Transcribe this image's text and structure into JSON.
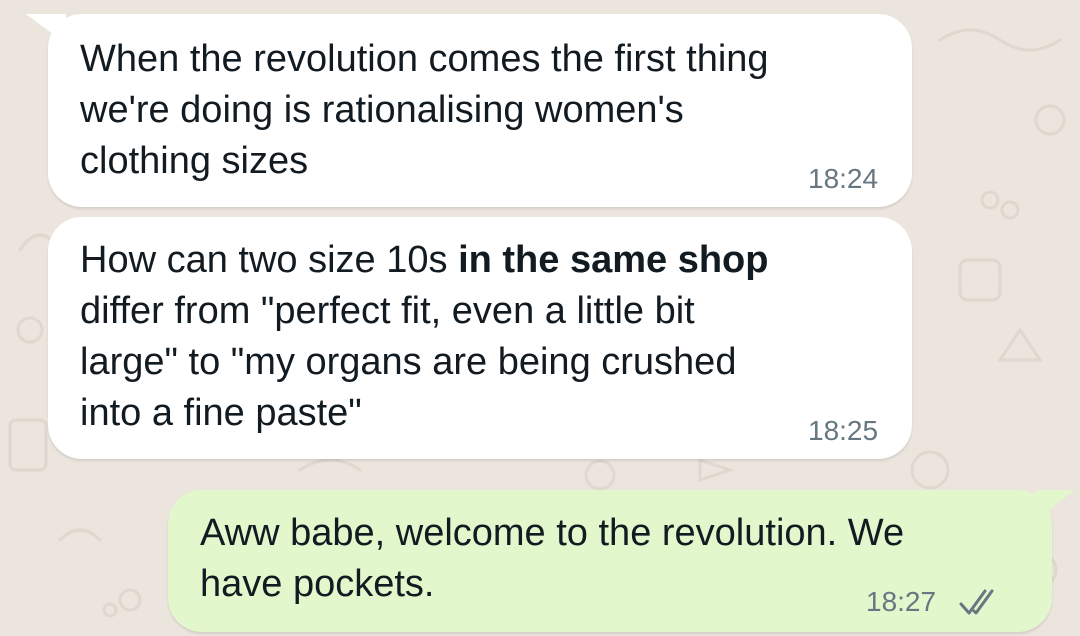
{
  "messages": [
    {
      "direction": "incoming",
      "text": "When the revolution comes the first thing\nwe're doing is rationalising women's\nclothing sizes",
      "time": "18:24"
    },
    {
      "direction": "incoming",
      "text_before_bold": "How can two size 10s ",
      "text_bold": "in the same shop",
      "text_after_bold": "\ndiffer from \"perfect fit, even a little bit\nlarge\" to \"my organs are being crushed\ninto a fine paste\"",
      "time": "18:25"
    },
    {
      "direction": "outgoing",
      "text": "Aww babe, welcome to the revolution. We\nhave pockets.",
      "time": "18:27",
      "status_icon": "double-check-read-icon"
    }
  ],
  "colors": {
    "wallpaper": "#ece5dd",
    "incoming_bubble": "#ffffff",
    "outgoing_bubble": "#e2f7cb",
    "timestamp": "#667781",
    "read_ticks": "#667781"
  }
}
